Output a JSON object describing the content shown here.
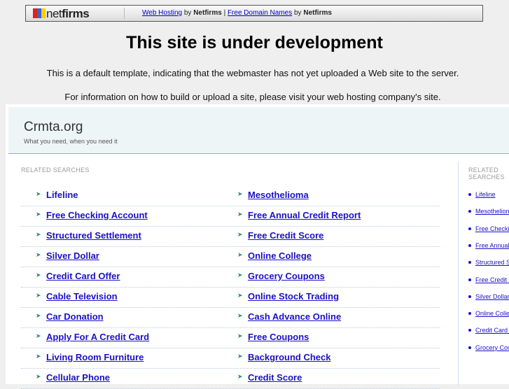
{
  "topbar": {
    "logo": "netfirms",
    "link1": "Web Hosting",
    "by1": "by",
    "brand1": "Netfirms",
    "divider": "|",
    "link2": "Free Domain Names",
    "by2": "by",
    "brand2": "Netfirms"
  },
  "title": "This site is under development",
  "para1": "This is a default template, indicating that the webmaster has not yet uploaded a Web site to the server.",
  "para2": "For information on how to build or upload a site, please visit your web hosting company's site.",
  "site": {
    "name": "Crmta.org",
    "tagline": "What you need, when you need it"
  },
  "related_heading": "RELATED SEARCHES",
  "left_items": [
    "Lifeline",
    "Free Checking Account",
    "Structured Settlement",
    "Silver Dollar",
    "Credit Card Offer",
    "Cable Television",
    "Car Donation",
    "Apply For A Credit Card",
    "Living Room Furniture",
    "Cellular Phone"
  ],
  "right_items": [
    "Mesothelioma",
    "Free Annual Credit Report",
    "Free Credit Score",
    "Online College",
    "Grocery Coupons",
    "Online Stock Trading",
    "Cash Advance Online",
    "Free Coupons",
    "Background Check",
    "Credit Score"
  ],
  "side_heading": "RELATED SEARCHES",
  "side_items": [
    "Lifeline",
    "Mesothelioma",
    "Free Checking Account",
    "Free Annual Credit Report",
    "Structured Settlement",
    "Free Credit Score",
    "Silver Dollar",
    "Online College",
    "Credit Card Offer",
    "Grocery Coupons"
  ]
}
